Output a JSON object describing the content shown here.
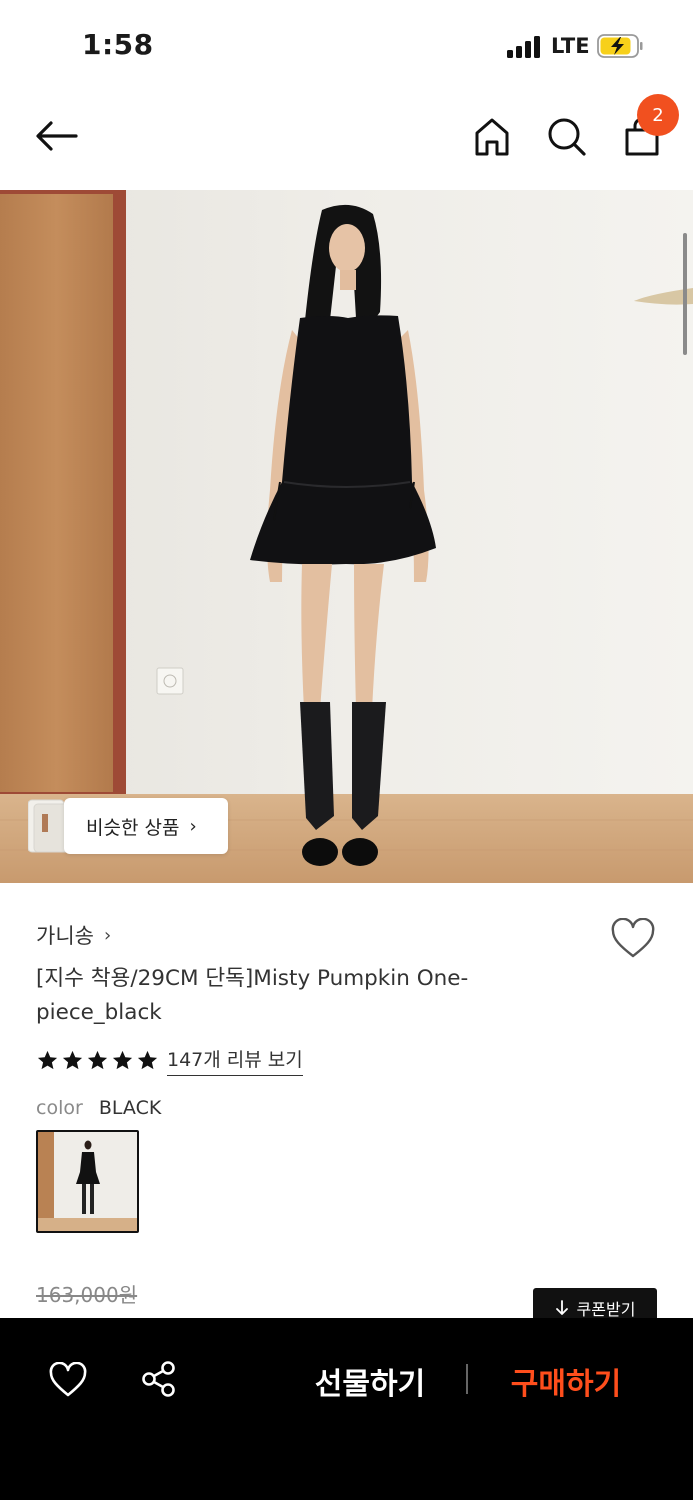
{
  "status_bar": {
    "time": "1:58",
    "network": "LTE",
    "signal_icon": "cellular-signal-icon",
    "battery_icon": "battery-charging-icon",
    "battery_color": "#f7d01a"
  },
  "nav": {
    "back_icon": "arrow-left-icon",
    "home_icon": "home-icon",
    "search_icon": "search-icon",
    "cart_icon": "shopping-bag-icon",
    "cart_count": "2",
    "badge_color": "#f1501f"
  },
  "hero": {
    "similar_label": "비슷한 상품",
    "similar_chevron": "›"
  },
  "product": {
    "brand": "가니송",
    "brand_chevron": "›",
    "title": "[지수 착용/29CM 단독]Misty Pumpkin One-piece_black",
    "rating_stars": 5,
    "reviews_label": "147개 리뷰 보기",
    "color_label": "color",
    "color_value": "BLACK",
    "original_price": "163,000원",
    "coupon_label": "쿠폰받기",
    "coupon_icon": "arrow-down-icon"
  },
  "bottom_bar": {
    "wishlist_icon": "heart-outline-icon",
    "share_icon": "share-icon",
    "gift_label": "선물하기",
    "buy_label": "구매하기",
    "buy_color": "#ff4e1c"
  }
}
